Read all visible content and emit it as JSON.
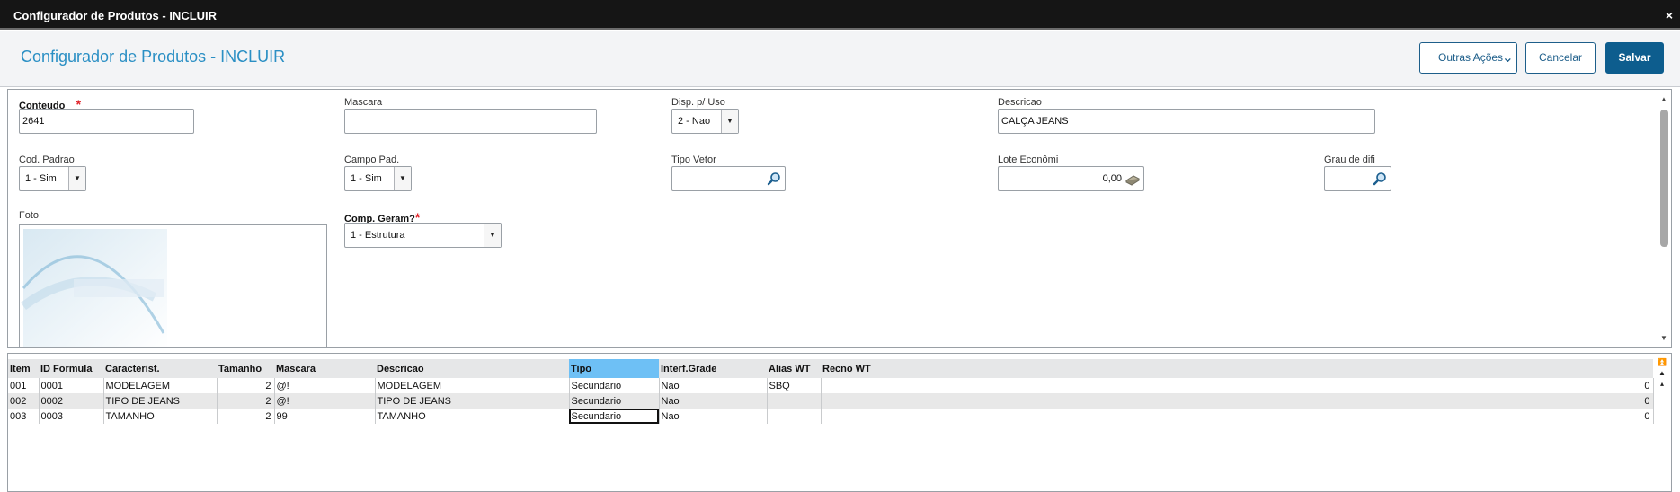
{
  "window": {
    "title": "Configurador de Produtos - INCLUIR",
    "close_glyph": "×"
  },
  "header": {
    "title": "Configurador de Produtos - INCLUIR",
    "buttons": {
      "more": "Outras Ações",
      "cancel": "Cancelar",
      "save": "Salvar"
    }
  },
  "form": {
    "conteudo": {
      "label": "Conteudo",
      "value": "2641"
    },
    "mascara": {
      "label": "Mascara",
      "value": ""
    },
    "disp_uso": {
      "label": "Disp. p/ Uso",
      "value": "2 - Nao"
    },
    "descricao": {
      "label": "Descricao",
      "value": "CALÇA JEANS"
    },
    "cod_padrao": {
      "label": "Cod. Padrao",
      "value": "1 - Sim"
    },
    "campo_pad": {
      "label": "Campo Pad.",
      "value": "1 - Sim"
    },
    "tipo_vetor": {
      "label": "Tipo Vetor",
      "value": ""
    },
    "lote_economico": {
      "label": "Lote Econômi",
      "value": "0,00"
    },
    "grau_difi": {
      "label": "Grau de difi",
      "value": ""
    },
    "foto": {
      "label": "Foto"
    },
    "comp_geram": {
      "label": "Comp. Geram?",
      "value": "1 - Estrutura"
    },
    "required_mark": "*"
  },
  "grid": {
    "columns": [
      "Item",
      "ID Formula",
      "Caracterist.",
      "Tamanho",
      "Mascara",
      "Descricao",
      "Tipo",
      "Interf.Grade",
      "Alias WT",
      "Recno WT"
    ],
    "rows": [
      [
        "001",
        "0001",
        "MODELAGEM",
        "2",
        "@!",
        "MODELAGEM",
        "Secundario",
        "Nao",
        "SBQ",
        "0"
      ],
      [
        "002",
        "0002",
        "TIPO DE JEANS",
        "2",
        "@!",
        "TIPO DE JEANS",
        "Secundario",
        "Nao",
        "",
        "0"
      ],
      [
        "003",
        "0003",
        "TAMANHO",
        "2",
        "99",
        "TAMANHO",
        "Secundario",
        "Nao",
        "",
        "0"
      ]
    ]
  },
  "colors": {
    "accent": "#2a8fc4",
    "primary_button": "#0d5d8e",
    "selected_column": "#6ec0f5",
    "required": "#e0252b"
  },
  "icons": [
    "close-icon",
    "chevron-down-icon",
    "search-icon",
    "calculator-icon",
    "scroll-up-icon",
    "scroll-down-icon",
    "first-record-icon",
    "previous-page-icon",
    "previous-record-icon"
  ]
}
